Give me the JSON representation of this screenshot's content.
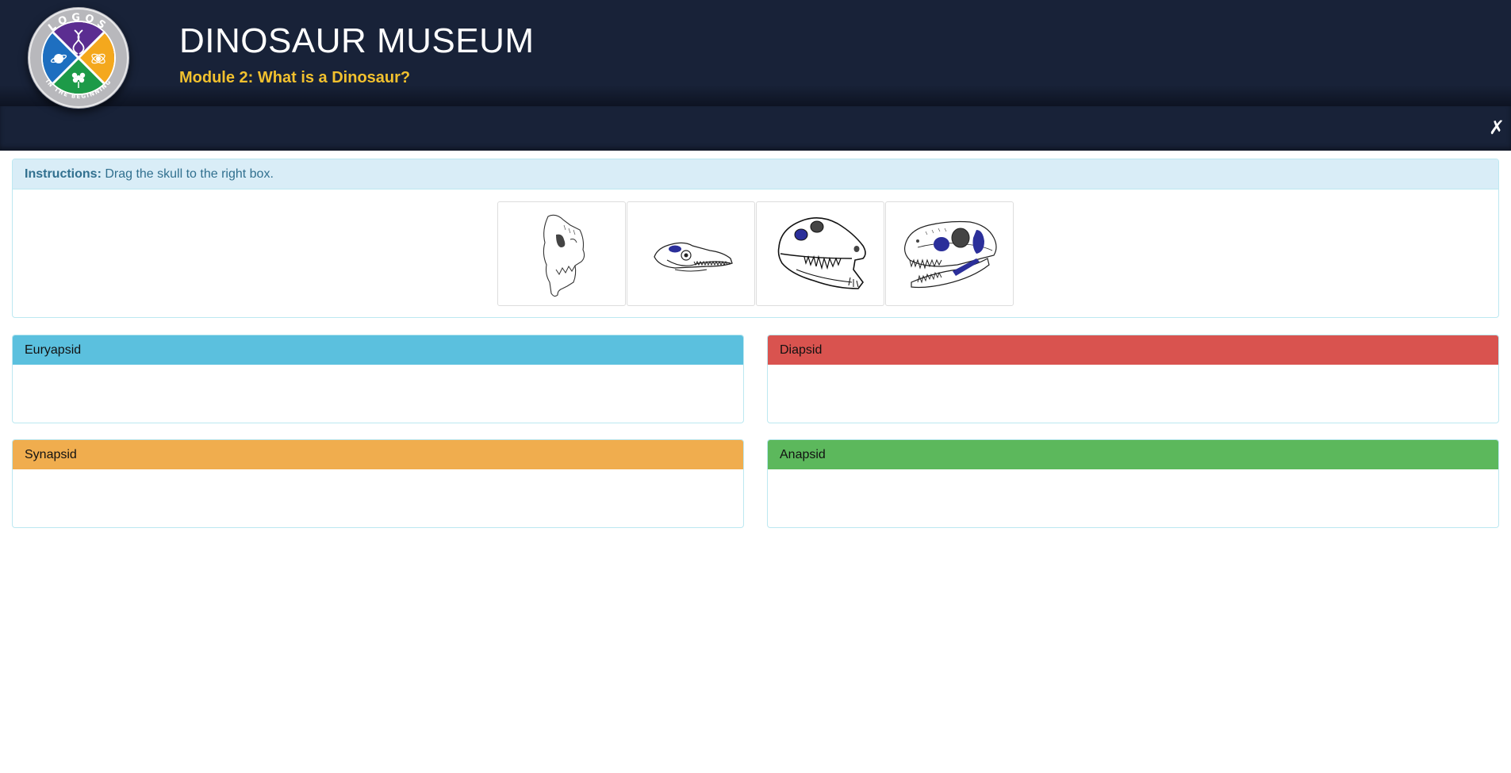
{
  "header": {
    "title": "DINOSAUR MUSEUM",
    "subtitle": "Module 2: What is a Dinosaur?",
    "logo_top_text": "LOGOS",
    "logo_bottom_text": "IN THE BEGINNING",
    "logo_icon": "logos-badge-icon"
  },
  "navbar": {
    "close_label": "✗"
  },
  "instructions": {
    "label": "Instructions:",
    "text": " Drag the skull to the right box."
  },
  "skulls": [
    {
      "name": "skull-1",
      "icon": "skull-upright-icon"
    },
    {
      "name": "skull-2",
      "icon": "skull-small-icon"
    },
    {
      "name": "skull-3",
      "icon": "skull-large-icon"
    },
    {
      "name": "skull-4",
      "icon": "skull-toothy-icon"
    }
  ],
  "drop_boxes": [
    {
      "label": "Euryapsid",
      "color": "#5bc0de"
    },
    {
      "label": "Diapsid",
      "color": "#d9534f"
    },
    {
      "label": "Synapsid",
      "color": "#f0ad4e"
    },
    {
      "label": "Anapsid",
      "color": "#5cb85c"
    }
  ],
  "colors": {
    "header_bg": "#182238",
    "subtitle": "#f2c12e",
    "skull_window_blue": "#2b2f9a",
    "skull_window_gray": "#444444"
  }
}
